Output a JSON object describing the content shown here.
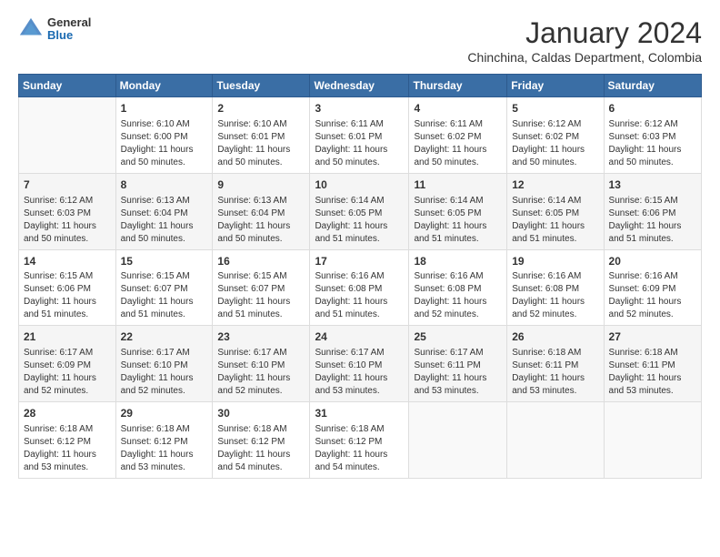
{
  "header": {
    "logo": {
      "general": "General",
      "blue": "Blue"
    },
    "title": "January 2024",
    "location": "Chinchina, Caldas Department, Colombia"
  },
  "weekdays": [
    "Sunday",
    "Monday",
    "Tuesday",
    "Wednesday",
    "Thursday",
    "Friday",
    "Saturday"
  ],
  "weeks": [
    [
      {
        "day": "",
        "sunrise": "",
        "sunset": "",
        "daylight": ""
      },
      {
        "day": "1",
        "sunrise": "Sunrise: 6:10 AM",
        "sunset": "Sunset: 6:00 PM",
        "daylight": "Daylight: 11 hours and 50 minutes."
      },
      {
        "day": "2",
        "sunrise": "Sunrise: 6:10 AM",
        "sunset": "Sunset: 6:01 PM",
        "daylight": "Daylight: 11 hours and 50 minutes."
      },
      {
        "day": "3",
        "sunrise": "Sunrise: 6:11 AM",
        "sunset": "Sunset: 6:01 PM",
        "daylight": "Daylight: 11 hours and 50 minutes."
      },
      {
        "day": "4",
        "sunrise": "Sunrise: 6:11 AM",
        "sunset": "Sunset: 6:02 PM",
        "daylight": "Daylight: 11 hours and 50 minutes."
      },
      {
        "day": "5",
        "sunrise": "Sunrise: 6:12 AM",
        "sunset": "Sunset: 6:02 PM",
        "daylight": "Daylight: 11 hours and 50 minutes."
      },
      {
        "day": "6",
        "sunrise": "Sunrise: 6:12 AM",
        "sunset": "Sunset: 6:03 PM",
        "daylight": "Daylight: 11 hours and 50 minutes."
      }
    ],
    [
      {
        "day": "7",
        "sunrise": "Sunrise: 6:12 AM",
        "sunset": "Sunset: 6:03 PM",
        "daylight": "Daylight: 11 hours and 50 minutes."
      },
      {
        "day": "8",
        "sunrise": "Sunrise: 6:13 AM",
        "sunset": "Sunset: 6:04 PM",
        "daylight": "Daylight: 11 hours and 50 minutes."
      },
      {
        "day": "9",
        "sunrise": "Sunrise: 6:13 AM",
        "sunset": "Sunset: 6:04 PM",
        "daylight": "Daylight: 11 hours and 50 minutes."
      },
      {
        "day": "10",
        "sunrise": "Sunrise: 6:14 AM",
        "sunset": "Sunset: 6:05 PM",
        "daylight": "Daylight: 11 hours and 51 minutes."
      },
      {
        "day": "11",
        "sunrise": "Sunrise: 6:14 AM",
        "sunset": "Sunset: 6:05 PM",
        "daylight": "Daylight: 11 hours and 51 minutes."
      },
      {
        "day": "12",
        "sunrise": "Sunrise: 6:14 AM",
        "sunset": "Sunset: 6:05 PM",
        "daylight": "Daylight: 11 hours and 51 minutes."
      },
      {
        "day": "13",
        "sunrise": "Sunrise: 6:15 AM",
        "sunset": "Sunset: 6:06 PM",
        "daylight": "Daylight: 11 hours and 51 minutes."
      }
    ],
    [
      {
        "day": "14",
        "sunrise": "Sunrise: 6:15 AM",
        "sunset": "Sunset: 6:06 PM",
        "daylight": "Daylight: 11 hours and 51 minutes."
      },
      {
        "day": "15",
        "sunrise": "Sunrise: 6:15 AM",
        "sunset": "Sunset: 6:07 PM",
        "daylight": "Daylight: 11 hours and 51 minutes."
      },
      {
        "day": "16",
        "sunrise": "Sunrise: 6:15 AM",
        "sunset": "Sunset: 6:07 PM",
        "daylight": "Daylight: 11 hours and 51 minutes."
      },
      {
        "day": "17",
        "sunrise": "Sunrise: 6:16 AM",
        "sunset": "Sunset: 6:08 PM",
        "daylight": "Daylight: 11 hours and 51 minutes."
      },
      {
        "day": "18",
        "sunrise": "Sunrise: 6:16 AM",
        "sunset": "Sunset: 6:08 PM",
        "daylight": "Daylight: 11 hours and 52 minutes."
      },
      {
        "day": "19",
        "sunrise": "Sunrise: 6:16 AM",
        "sunset": "Sunset: 6:08 PM",
        "daylight": "Daylight: 11 hours and 52 minutes."
      },
      {
        "day": "20",
        "sunrise": "Sunrise: 6:16 AM",
        "sunset": "Sunset: 6:09 PM",
        "daylight": "Daylight: 11 hours and 52 minutes."
      }
    ],
    [
      {
        "day": "21",
        "sunrise": "Sunrise: 6:17 AM",
        "sunset": "Sunset: 6:09 PM",
        "daylight": "Daylight: 11 hours and 52 minutes."
      },
      {
        "day": "22",
        "sunrise": "Sunrise: 6:17 AM",
        "sunset": "Sunset: 6:10 PM",
        "daylight": "Daylight: 11 hours and 52 minutes."
      },
      {
        "day": "23",
        "sunrise": "Sunrise: 6:17 AM",
        "sunset": "Sunset: 6:10 PM",
        "daylight": "Daylight: 11 hours and 52 minutes."
      },
      {
        "day": "24",
        "sunrise": "Sunrise: 6:17 AM",
        "sunset": "Sunset: 6:10 PM",
        "daylight": "Daylight: 11 hours and 53 minutes."
      },
      {
        "day": "25",
        "sunrise": "Sunrise: 6:17 AM",
        "sunset": "Sunset: 6:11 PM",
        "daylight": "Daylight: 11 hours and 53 minutes."
      },
      {
        "day": "26",
        "sunrise": "Sunrise: 6:18 AM",
        "sunset": "Sunset: 6:11 PM",
        "daylight": "Daylight: 11 hours and 53 minutes."
      },
      {
        "day": "27",
        "sunrise": "Sunrise: 6:18 AM",
        "sunset": "Sunset: 6:11 PM",
        "daylight": "Daylight: 11 hours and 53 minutes."
      }
    ],
    [
      {
        "day": "28",
        "sunrise": "Sunrise: 6:18 AM",
        "sunset": "Sunset: 6:12 PM",
        "daylight": "Daylight: 11 hours and 53 minutes."
      },
      {
        "day": "29",
        "sunrise": "Sunrise: 6:18 AM",
        "sunset": "Sunset: 6:12 PM",
        "daylight": "Daylight: 11 hours and 53 minutes."
      },
      {
        "day": "30",
        "sunrise": "Sunrise: 6:18 AM",
        "sunset": "Sunset: 6:12 PM",
        "daylight": "Daylight: 11 hours and 54 minutes."
      },
      {
        "day": "31",
        "sunrise": "Sunrise: 6:18 AM",
        "sunset": "Sunset: 6:12 PM",
        "daylight": "Daylight: 11 hours and 54 minutes."
      },
      {
        "day": "",
        "sunrise": "",
        "sunset": "",
        "daylight": ""
      },
      {
        "day": "",
        "sunrise": "",
        "sunset": "",
        "daylight": ""
      },
      {
        "day": "",
        "sunrise": "",
        "sunset": "",
        "daylight": ""
      }
    ]
  ]
}
